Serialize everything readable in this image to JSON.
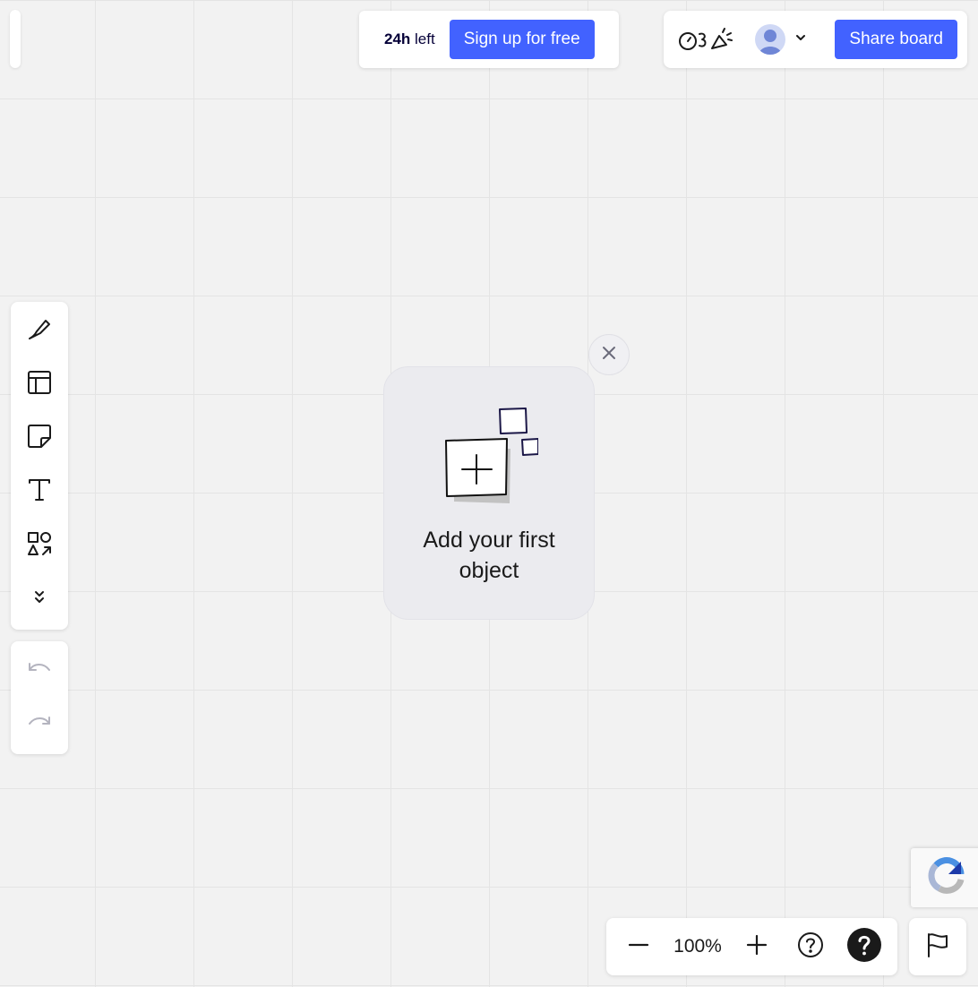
{
  "trial": {
    "time": "24h",
    "suffix": "left",
    "signup_label": "Sign up for free"
  },
  "header": {
    "share_label": "Share board"
  },
  "toolbar": {
    "tools": [
      "pen",
      "frames",
      "sticky-note",
      "text",
      "shapes",
      "more"
    ]
  },
  "empty_state": {
    "title": "Add your first object"
  },
  "zoom": {
    "level": "100%"
  },
  "colors": {
    "accent": "#4262ff",
    "canvas": "#f2f2f2",
    "text_dark": "#050038"
  }
}
